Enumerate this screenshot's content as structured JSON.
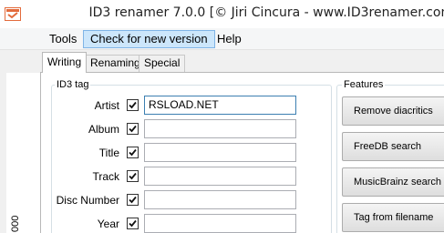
{
  "window": {
    "title": "ID3 renamer 7.0.0 [© Jiri Cincura - www.ID3renamer.com]",
    "icon": "app-icon"
  },
  "menu": {
    "items": [
      {
        "label": "Tools"
      },
      {
        "label": "Check for new version",
        "active": true
      },
      {
        "label": "Help"
      }
    ]
  },
  "tabs": [
    {
      "label": "Writing",
      "selected": true
    },
    {
      "label": "Renaming"
    },
    {
      "label": "Special"
    }
  ],
  "id3_group": {
    "title": "ID3 tag",
    "fields": [
      {
        "label": "Artist",
        "checked": true,
        "value": "RSLOAD.NET"
      },
      {
        "label": "Album",
        "checked": true,
        "value": ""
      },
      {
        "label": "Title",
        "checked": true,
        "value": ""
      },
      {
        "label": "Track",
        "checked": true,
        "value": ""
      },
      {
        "label": "Disc Number",
        "checked": true,
        "value": ""
      },
      {
        "label": "Year",
        "checked": true,
        "value": ""
      }
    ]
  },
  "features_group": {
    "title": "Features",
    "buttons": [
      {
        "label": "Remove diacritics"
      },
      {
        "label": "FreeDB search"
      },
      {
        "label": "MusicBrainz search"
      },
      {
        "label": "Tag from filename"
      }
    ]
  },
  "side_text": "000"
}
